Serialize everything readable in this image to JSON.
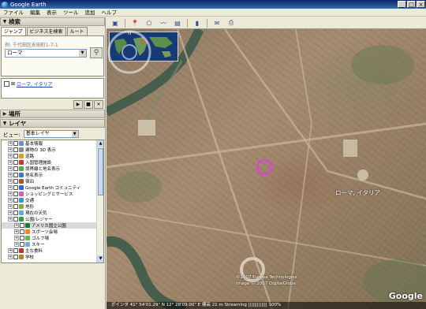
{
  "window": {
    "title": "Google Earth"
  },
  "menu": [
    "ファイル",
    "編集",
    "表示",
    "ツール",
    "追加",
    "ヘルプ"
  ],
  "search": {
    "header": "検索",
    "tabs": [
      "ジャンプ",
      "ビジネスを検索",
      "ルート"
    ],
    "hint": "例: 千代田区永田町1-7-1",
    "query": "ローマ",
    "result": "ローマ, イタリア"
  },
  "places": {
    "header": "場所"
  },
  "layers": {
    "header": "レイヤ",
    "view_label": "ビュー:",
    "view_value": "基本レイヤ",
    "items": [
      {
        "label": "基本情報",
        "color": "#6a8fd0"
      },
      {
        "label": "建物の 3D 表示",
        "color": "#8a8a8a"
      },
      {
        "label": "道路",
        "color": "#d4a020"
      },
      {
        "label": "入国管理施設",
        "color": "#cc3333"
      },
      {
        "label": "境界線と地名表示",
        "color": "#55aa55"
      },
      {
        "label": "地名表示",
        "color": "#4477cc"
      },
      {
        "label": "宿泊",
        "color": "#aa5522"
      },
      {
        "label": "Google Earth コミュニティ",
        "color": "#3366cc"
      },
      {
        "label": "ショッピングとサービス",
        "color": "#cc66aa"
      },
      {
        "label": "交通",
        "color": "#3399cc"
      },
      {
        "label": "地形",
        "color": "#88aa44"
      },
      {
        "label": "現在の天気",
        "color": "#66aadd"
      },
      {
        "label": "公園/レジャー",
        "color": "#339944"
      },
      {
        "label": "アメリカ国立公園",
        "color": "#227733"
      },
      {
        "label": "スポーツ会場",
        "color": "#ee8822"
      },
      {
        "label": "ゴルフ場",
        "color": "#55bb55"
      },
      {
        "label": "スキー",
        "color": "#77aadd"
      },
      {
        "label": "主な食料",
        "color": "#bb3333"
      },
      {
        "label": "学校",
        "color": "#aa8833"
      }
    ]
  },
  "map": {
    "place_label": "ローマ, イタリア",
    "copyright": [
      "©2007 Europa Technologies",
      "Image © 2007 DigitalGlobe"
    ],
    "status": "ポインタ 41° 54'01.29\" N 12° 28'09.00\" E  標高 21 m    Streaming ||||||||||||| 100%",
    "logo": "Google"
  }
}
